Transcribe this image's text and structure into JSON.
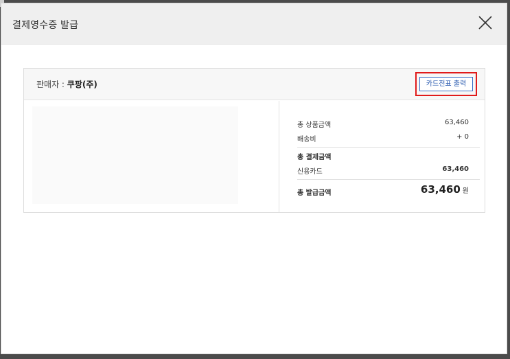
{
  "modal": {
    "title": "결제영수증 발급",
    "close_icon": "close-icon"
  },
  "card": {
    "seller_label": "판매자 : ",
    "seller_name": "쿠팡(주)",
    "print_button": "카드전표 출력",
    "highlight_color": "#e01a1a",
    "button_color": "#3a6fc6"
  },
  "summary": {
    "product_total_label": "총 상품금액",
    "product_total_value": "63,460",
    "shipping_label": "배송비",
    "shipping_value": "+ 0",
    "payment_total_label": "총 결제금액",
    "card_label": "신용카드",
    "card_value": "63,460",
    "issue_total_label": "총 발급금액",
    "issue_total_value": "63,460",
    "currency_unit": "원"
  }
}
